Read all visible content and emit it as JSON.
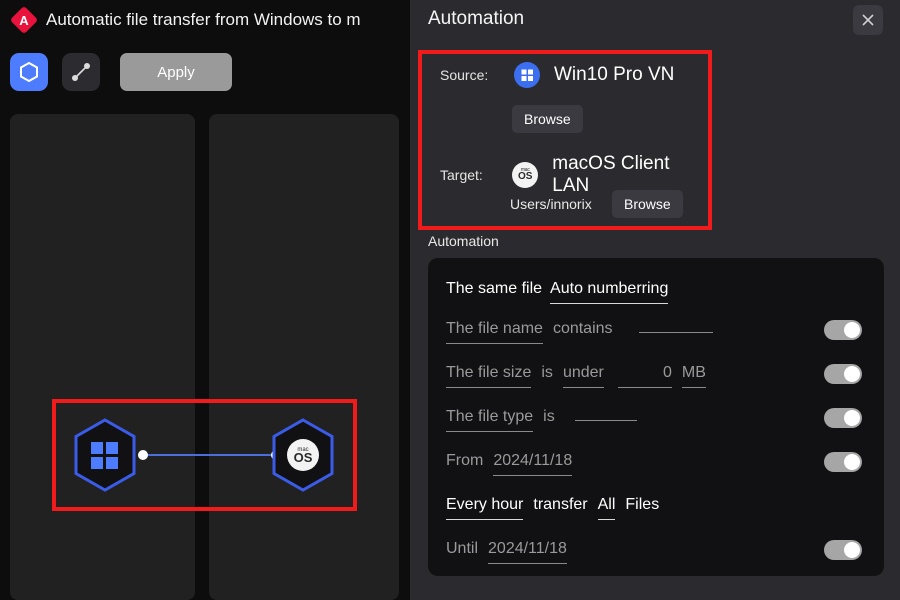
{
  "window": {
    "app_icon": "angular-diamond-icon",
    "title": "Automatic file transfer from Windows to m"
  },
  "toolbar": {
    "node_tool": {
      "icon": "hexagon-node-icon",
      "label": "Node tool",
      "active": true
    },
    "link_tool": {
      "icon": "link-line-icon",
      "label": "Link tool",
      "active": false
    },
    "apply_label": "Apply"
  },
  "canvas": {
    "nodes": [
      {
        "id": "source-node",
        "icon": "windows-logo-icon",
        "os": "windows"
      },
      {
        "id": "target-node",
        "icon": "macos-logo-icon",
        "os": "macos",
        "mac_top": "mac",
        "mac_bottom": "OS"
      }
    ],
    "selection_color": "#f21b1b",
    "node_accent": "#3b5ce8",
    "link_color": "#4a6fdc"
  },
  "panel": {
    "title": "Automation",
    "close_icon": "close-icon",
    "highlight_color": "#f21b1b",
    "source": {
      "label": "Source:",
      "icon": "windows-logo-icon",
      "name": "Win10 Pro VN",
      "browse_label": "Browse"
    },
    "target": {
      "label": "Target:",
      "icon": "macos-logo-icon",
      "mac_top": "mac",
      "mac_bottom": "OS",
      "name": "macOS Client LAN",
      "path": "Users/innorix",
      "browse_label": "Browse"
    },
    "section_label": "Automation"
  },
  "rules": {
    "same_file": {
      "label": "The same file",
      "value": "Auto numberring"
    },
    "file_name": {
      "label": "The file name",
      "operator": "contains",
      "value": "",
      "toggle_on": true
    },
    "file_size": {
      "label": "The file size",
      "verb": "is",
      "operator": "under",
      "value": "0",
      "unit": "MB",
      "toggle_on": true
    },
    "file_type": {
      "label": "The file type",
      "verb": "is",
      "value": "",
      "toggle_on": true
    },
    "from": {
      "label": "From",
      "value": "2024/11/18",
      "toggle_on": true
    },
    "schedule": {
      "frequency": "Every hour",
      "verb": "transfer",
      "scope": "All",
      "object": "Files"
    },
    "until": {
      "label": "Until",
      "value": "2024/11/18",
      "toggle_on": true
    }
  }
}
